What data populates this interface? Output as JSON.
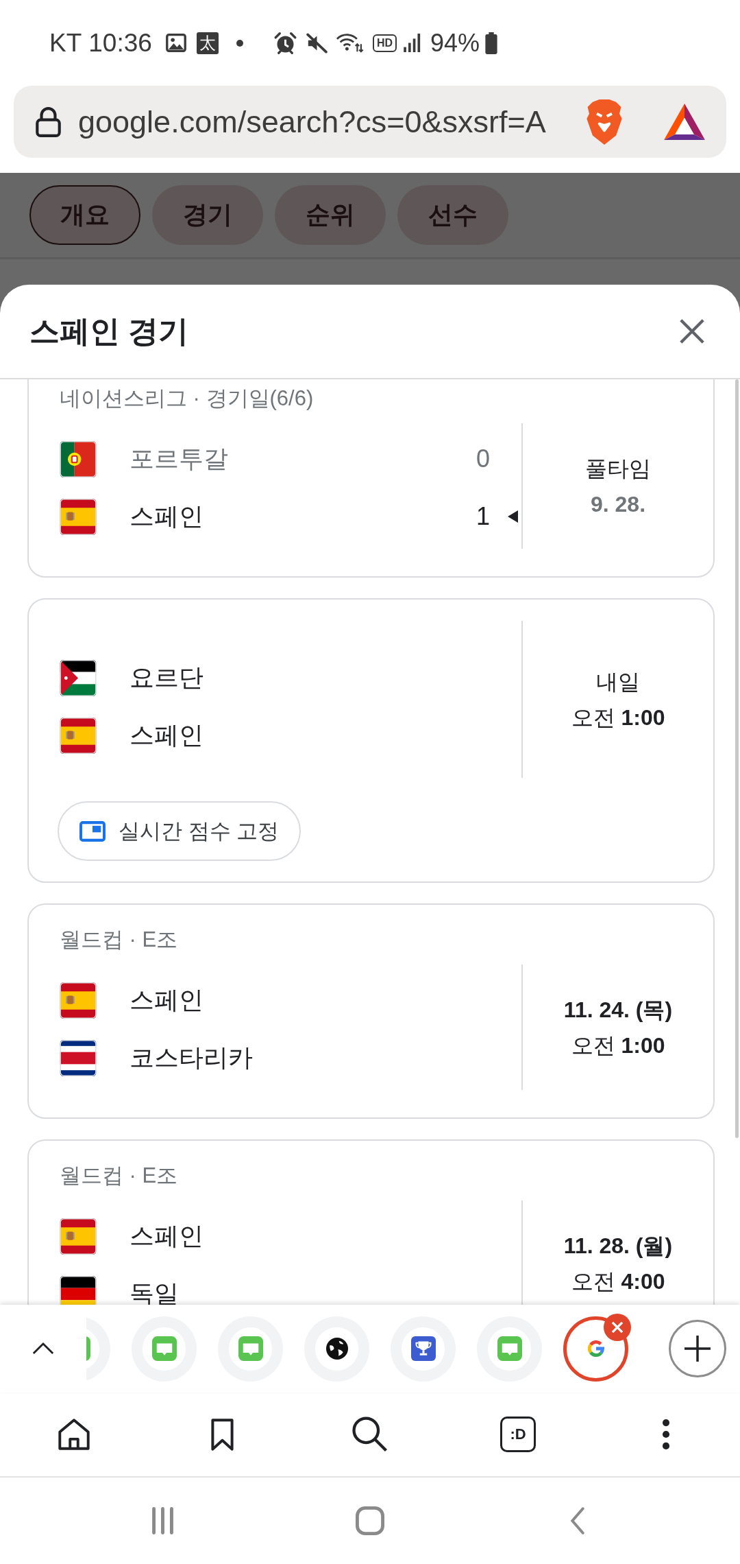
{
  "status_bar": {
    "carrier": "KT",
    "time": "10:36",
    "app_badge": "太",
    "hd_badge": "HD",
    "battery": "94%"
  },
  "address_bar": {
    "url": "google.com/search?cs=0&sxsrf=A"
  },
  "page": {
    "tabs": [
      {
        "label": "개요",
        "selected": true
      },
      {
        "label": "경기",
        "selected": false
      },
      {
        "label": "순위",
        "selected": false
      },
      {
        "label": "선수",
        "selected": false
      }
    ]
  },
  "sheet": {
    "title": "스페인 경기",
    "matches": [
      {
        "competition": "네이션스리그 · 경기일(6/6)",
        "teams": [
          {
            "name": "포르투갈",
            "kind": "portugal",
            "score": "0",
            "winner": false
          },
          {
            "name": "스페인",
            "kind": "spain",
            "score": "1",
            "winner": true
          }
        ],
        "status": [
          {
            "text": "풀타임",
            "kind": "plain"
          },
          {
            "text": "9. 28.",
            "kind": "muted"
          }
        ]
      },
      {
        "teams": [
          {
            "name": "요르단",
            "kind": "jordan"
          },
          {
            "name": "스페인",
            "kind": "spain"
          }
        ],
        "status": [
          {
            "text": "내일",
            "kind": "plain"
          },
          {
            "text": "오전 **1:00**",
            "kind": "plain"
          }
        ],
        "action": {
          "label": "실시간 점수 고정"
        }
      },
      {
        "competition": "월드컵 · E조",
        "teams": [
          {
            "name": "스페인",
            "kind": "spain"
          },
          {
            "name": "코스타리카",
            "kind": "costarica"
          }
        ],
        "status": [
          {
            "text": "11. 24. (목)",
            "kind": "strong"
          },
          {
            "text": "오전 **1:00**",
            "kind": "plain"
          }
        ]
      },
      {
        "competition": "월드컵 · E조",
        "teams": [
          {
            "name": "스페인",
            "kind": "spain"
          },
          {
            "name": "독일",
            "kind": "germany"
          }
        ],
        "status": [
          {
            "text": "11. 28. (월)",
            "kind": "strong"
          },
          {
            "text": "오전 **4:00**",
            "kind": "plain"
          }
        ]
      }
    ]
  },
  "tab_switcher": {
    "tabs": [
      {
        "kind": "blog",
        "selected": false
      },
      {
        "kind": "blog",
        "selected": false
      },
      {
        "kind": "blog",
        "selected": false
      },
      {
        "kind": "globe",
        "selected": false
      },
      {
        "kind": "trophy",
        "selected": false
      },
      {
        "kind": "blog",
        "selected": false
      },
      {
        "kind": "google",
        "selected": true
      }
    ]
  },
  "bottom_nav": {
    "tab_count": ":D"
  }
}
